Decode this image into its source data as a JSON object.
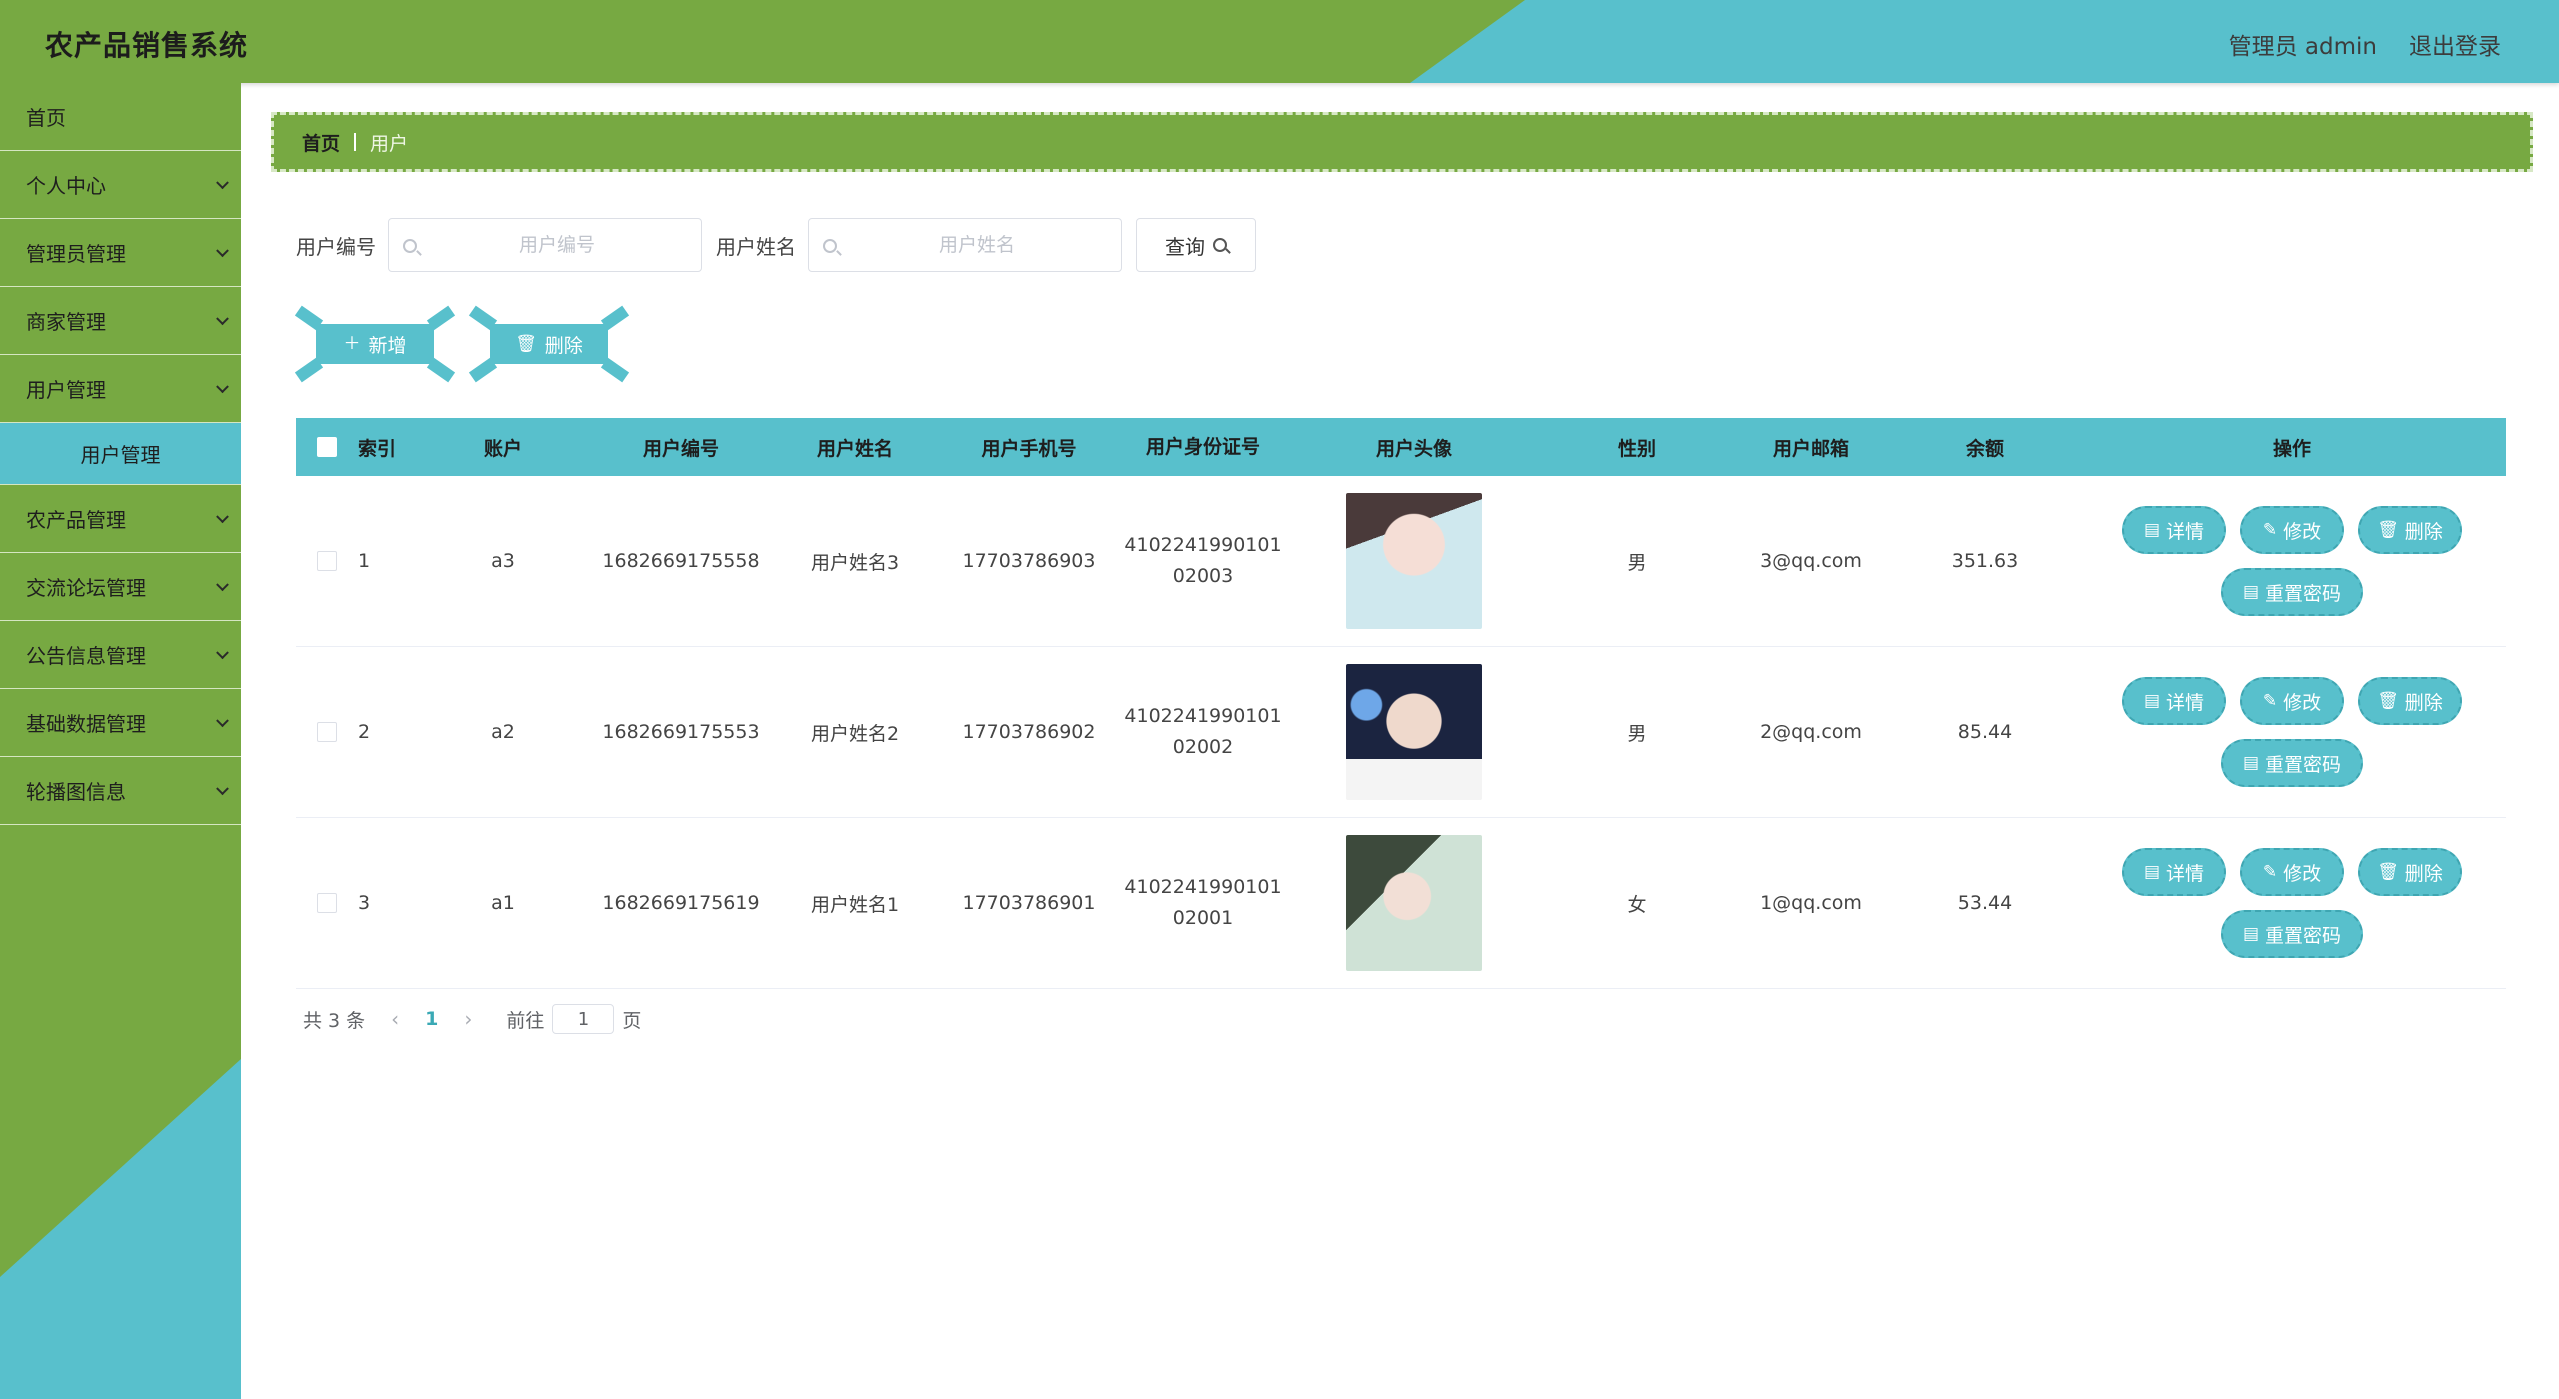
{
  "header": {
    "title": "农产品销售系统",
    "user_label": "管理员 admin",
    "logout_label": "退出登录"
  },
  "sidebar": {
    "items": [
      {
        "label": "首页",
        "chevron": false
      },
      {
        "label": "个人中心",
        "chevron": true
      },
      {
        "label": "管理员管理",
        "chevron": true
      },
      {
        "label": "商家管理",
        "chevron": true
      },
      {
        "label": "用户管理",
        "chevron": true
      },
      {
        "label": "用户管理",
        "sub": true
      },
      {
        "label": "农产品管理",
        "chevron": true
      },
      {
        "label": "交流论坛管理",
        "chevron": true
      },
      {
        "label": "公告信息管理",
        "chevron": true
      },
      {
        "label": "基础数据管理",
        "chevron": true
      },
      {
        "label": "轮播图信息",
        "chevron": true
      }
    ]
  },
  "breadcrumb": {
    "home": "首页",
    "current": "用户"
  },
  "search": {
    "field1_label": "用户编号",
    "field1_placeholder": "用户编号",
    "field2_label": "用户姓名",
    "field2_placeholder": "用户姓名",
    "query_label": "查询"
  },
  "actions": {
    "add_label": "新增",
    "delete_label": "删除"
  },
  "table": {
    "headers": [
      "索引",
      "账户",
      "用户编号",
      "用户姓名",
      "用户手机号",
      "用户身份证号",
      "用户头像",
      "性别",
      "用户邮箱",
      "余额",
      "操作"
    ],
    "rows": [
      {
        "index": "1",
        "account": "a3",
        "user_no": "1682669175558",
        "name": "用户姓名3",
        "phone": "17703786903",
        "id_line1": "4102241990101",
        "id_line2": "02003",
        "gender": "男",
        "email": "3@qq.com",
        "balance": "351.63"
      },
      {
        "index": "2",
        "account": "a2",
        "user_no": "1682669175553",
        "name": "用户姓名2",
        "phone": "17703786902",
        "id_line1": "4102241990101",
        "id_line2": "02002",
        "gender": "男",
        "email": "2@qq.com",
        "balance": "85.44"
      },
      {
        "index": "3",
        "account": "a1",
        "user_no": "1682669175619",
        "name": "用户姓名1",
        "phone": "17703786901",
        "id_line1": "4102241990101",
        "id_line2": "02001",
        "gender": "女",
        "email": "1@qq.com",
        "balance": "53.44"
      }
    ],
    "ops": {
      "detail": "详情",
      "edit": "修改",
      "delete": "删除",
      "reset": "重置密码"
    }
  },
  "pagination": {
    "total": "共 3 条",
    "current_page": "1",
    "goto_label": "前往",
    "goto_value": "1",
    "page_suffix": "页"
  },
  "colors": {
    "green": "#77a942",
    "teal": "#58c0cc"
  }
}
